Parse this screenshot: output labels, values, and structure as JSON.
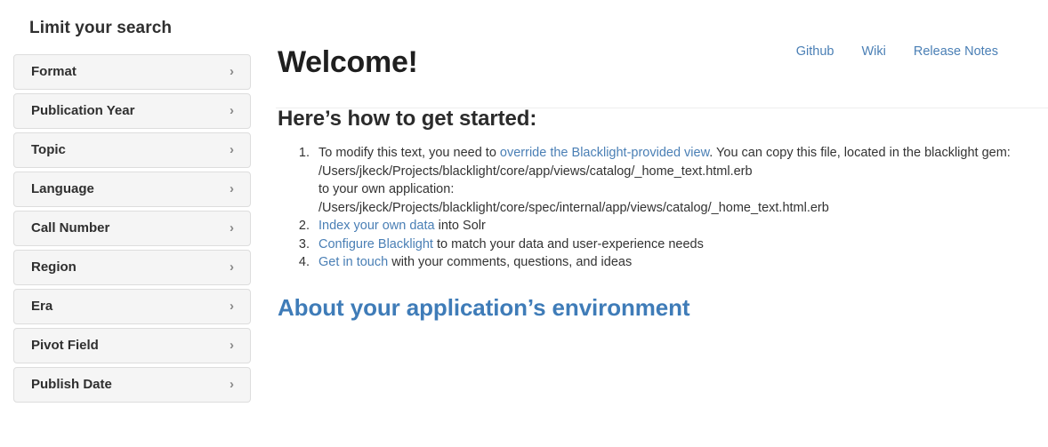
{
  "sidebar": {
    "title": "Limit your search",
    "chevron_glyph": "›",
    "facets": [
      {
        "label": "Format"
      },
      {
        "label": "Publication Year"
      },
      {
        "label": "Topic"
      },
      {
        "label": "Language"
      },
      {
        "label": "Call Number"
      },
      {
        "label": "Region"
      },
      {
        "label": "Era"
      },
      {
        "label": "Pivot Field"
      },
      {
        "label": "Publish Date"
      }
    ]
  },
  "top_links": [
    {
      "label": "Github"
    },
    {
      "label": "Wiki"
    },
    {
      "label": "Release Notes"
    }
  ],
  "main": {
    "welcome_title": "Welcome!",
    "subheading": "Here’s how to get started:",
    "steps": {
      "one": {
        "text_before_link": "To modify this text, you need to ",
        "link_label": "override the Blacklight-provided view",
        "text_after_link": ". You can copy this file, located in the blacklight gem:",
        "gem_path": "/Users/jkeck/Projects/blacklight/core/app/views/catalog/_home_text.html.erb",
        "app_intro": "to your own application:",
        "app_path": "/Users/jkeck/Projects/blacklight/core/spec/internal/app/views/catalog/_home_text.html.erb"
      },
      "two": {
        "link_label": "Index your own data",
        "text_after_link": " into Solr"
      },
      "three": {
        "link_label": "Configure Blacklight",
        "text_after_link": " to match your data and user-experience needs"
      },
      "four": {
        "link_label": "Get in touch",
        "text_after_link": " with your comments, questions, and ideas"
      }
    },
    "about_link_label": "About your application’s environment"
  },
  "colors": {
    "link_blue": "#4a7fb5",
    "heading_blue": "#3f7cb8",
    "panel_bg": "#f5f5f5",
    "panel_border": "#dddddd",
    "text": "#333333",
    "divider": "#eeeeee"
  }
}
